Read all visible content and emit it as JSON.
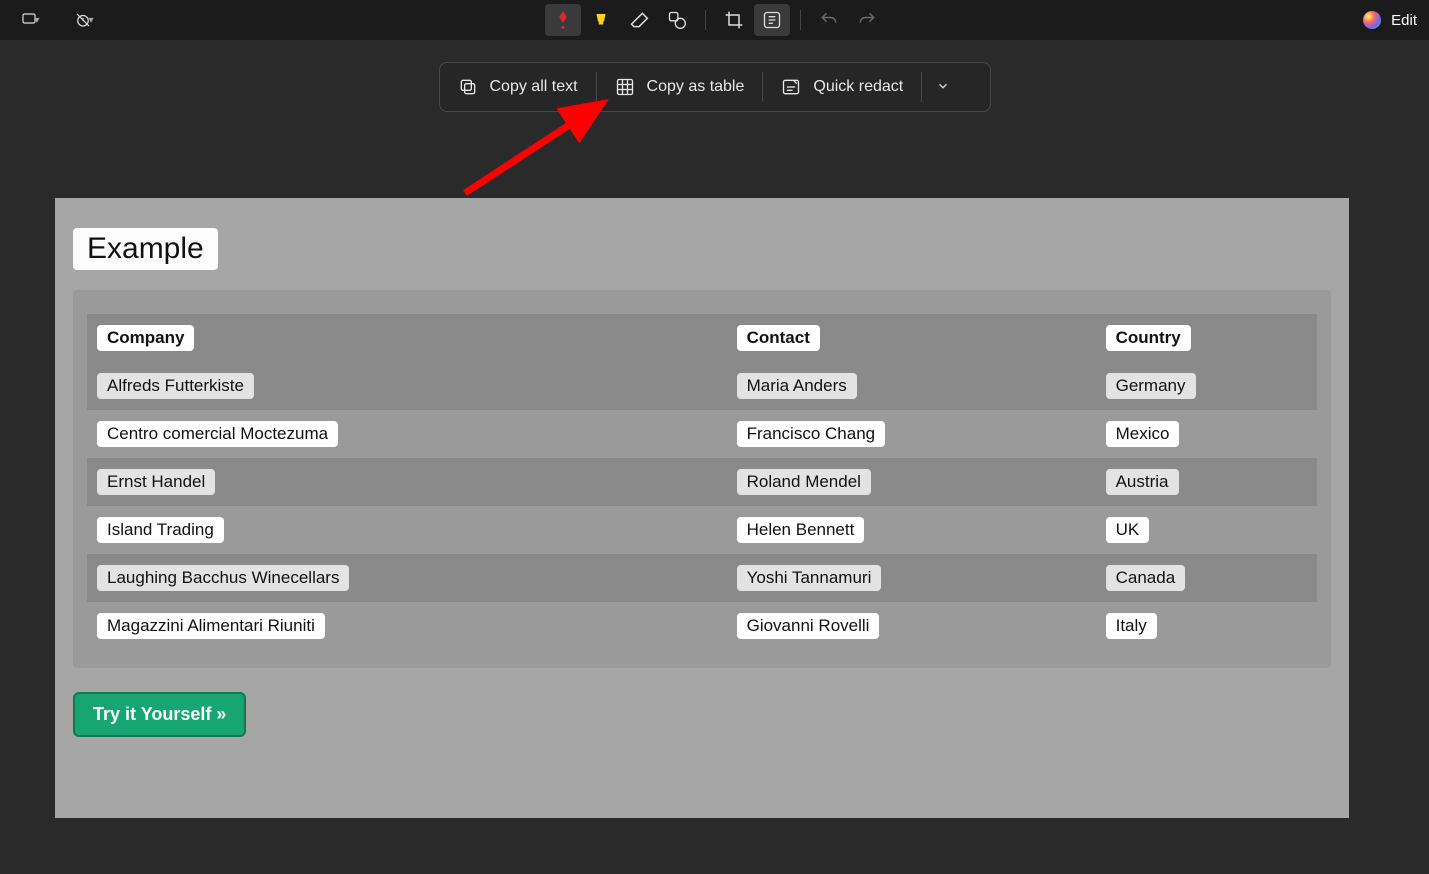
{
  "toolbar": {
    "edit_label": "Edit"
  },
  "actions": {
    "copy_all": "Copy all text",
    "copy_table": "Copy as table",
    "quick_redact": "Quick redact"
  },
  "heading": "Example",
  "table": {
    "headers": [
      "Company",
      "Contact",
      "Country"
    ],
    "rows": [
      [
        "Alfreds Futterkiste",
        "Maria Anders",
        "Germany"
      ],
      [
        "Centro comercial Moctezuma",
        "Francisco Chang",
        "Mexico"
      ],
      [
        "Ernst Handel",
        "Roland Mendel",
        "Austria"
      ],
      [
        "Island Trading",
        "Helen Bennett",
        "UK"
      ],
      [
        "Laughing Bacchus Winecellars",
        "Yoshi Tannamuri",
        "Canada"
      ],
      [
        "Magazzini Alimentari Riuniti",
        "Giovanni Rovelli",
        "Italy"
      ]
    ]
  },
  "try_button": "Try it Yourself »"
}
